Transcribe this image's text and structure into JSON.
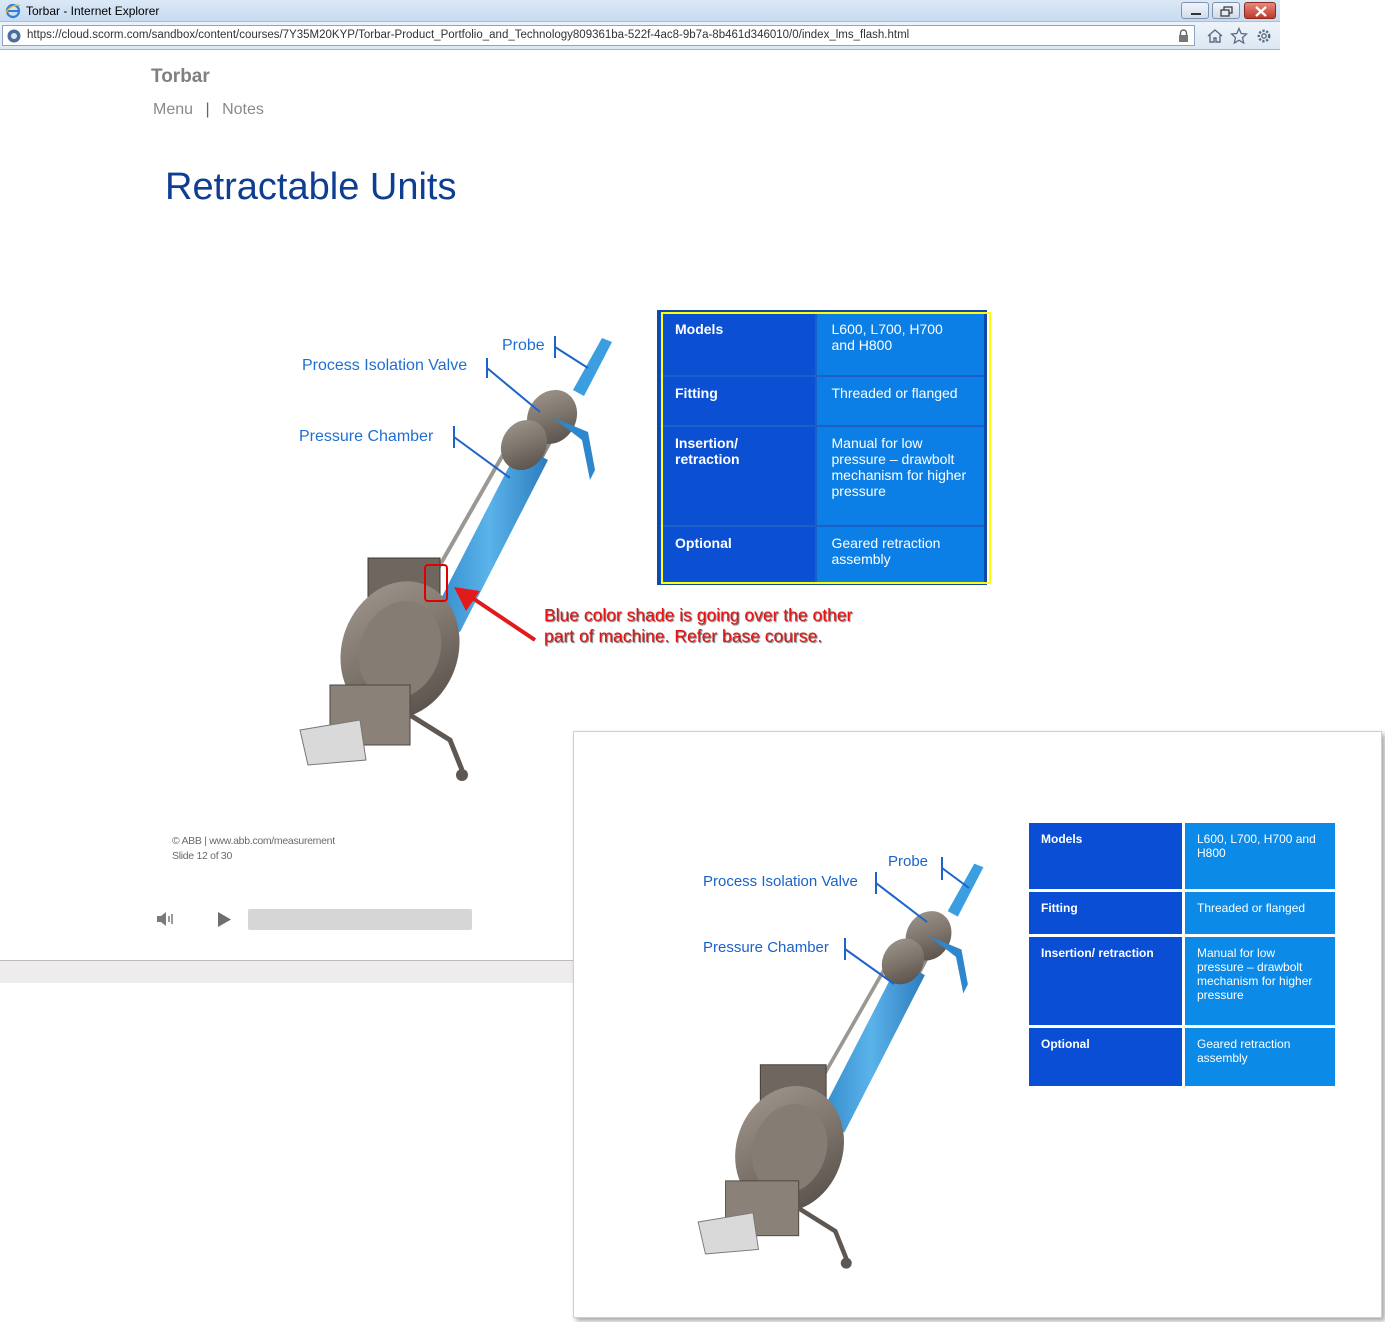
{
  "window": {
    "title": "Torbar - Internet Explorer",
    "url": "https://cloud.scorm.com/sandbox/content/courses/7Y35M20KYP/Torbar-Product_Portfolio_and_Technology809361ba-522f-4ac8-9b7a-8b461d346010/0/index_lms_flash.html"
  },
  "header": {
    "brand": "Torbar",
    "nav": {
      "menu": "Menu",
      "separator": "|",
      "notes": "Notes"
    }
  },
  "slide": {
    "title": "Retractable Units",
    "labels": {
      "probe": "Probe",
      "valve": "Process Isolation Valve",
      "chamber": "Pressure Chamber"
    },
    "table": [
      {
        "key": "Models",
        "value": "L600, L700, H700 and H800"
      },
      {
        "key": "Fitting",
        "value": "Threaded or flanged"
      },
      {
        "key": "Insertion/ retraction",
        "value": "Manual for low pressure – drawbolt mechanism for higher pressure"
      },
      {
        "key": "Optional",
        "value": "Geared retraction assembly"
      }
    ],
    "annotation": "Blue color shade is going over the other part of machine. Refer base course.",
    "footer": {
      "copyright": "© ABB | www.abb.com/measurement",
      "slide_counter": "Slide 12 of 30"
    }
  },
  "player": {
    "progress": 0
  },
  "reference": {
    "labels": {
      "probe": "Probe",
      "valve": "Process Isolation Valve",
      "chamber": "Pressure Chamber"
    },
    "table": [
      {
        "key": "Models",
        "value": "L600, L700, H700 and H800"
      },
      {
        "key": "Fitting",
        "value": "Threaded or flanged"
      },
      {
        "key": "Insertion/ retraction",
        "value": "Manual for low pressure – drawbolt mechanism for higher pressure"
      },
      {
        "key": "Optional",
        "value": "Geared retraction assembly"
      }
    ]
  },
  "colors": {
    "title_blue": "#0f3d91",
    "label_blue": "#1f6fd2",
    "table_key": "#0b4fd3",
    "table_value": "#0b7fe6",
    "annotation_red": "#e81010",
    "highlight_yellow": "#ffff00"
  }
}
